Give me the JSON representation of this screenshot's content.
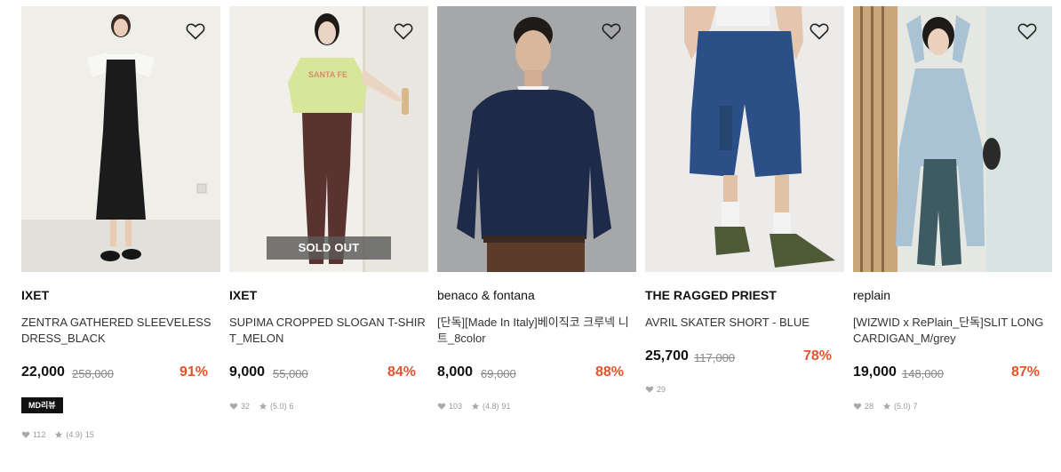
{
  "products": [
    {
      "brand": "IXET",
      "name": "ZENTRA GATHERED SLEEVELESS DRESS_BLACK",
      "price": "22,000",
      "original_price": "258,000",
      "discount": "91%",
      "badge": "MD리뷰",
      "likes": "112",
      "rating": "(4.9)",
      "reviews": "15",
      "image_icon": "woman-in-black-dress-photo"
    },
    {
      "brand": "IXET",
      "name": "SUPIMA CROPPED SLOGAN T-SHIRT_MELON",
      "price": "9,000",
      "original_price": "55,000",
      "discount": "84%",
      "overlay": "SOLD OUT",
      "likes": "32",
      "rating": "(5.0)",
      "reviews": "6",
      "image_icon": "woman-in-green-tshirt-photo"
    },
    {
      "brand": "benaco & fontana",
      "name": "[단독][Made In Italy]베이직코 크루넥 니트_8color",
      "price": "8,000",
      "original_price": "69,000",
      "discount": "88%",
      "likes": "103",
      "rating": "(4.8)",
      "reviews": "91",
      "image_icon": "man-in-navy-sweater-photo"
    },
    {
      "brand": "THE RAGGED PRIEST",
      "name": "AVRIL SKATER SHORT - BLUE",
      "price": "25,700",
      "original_price": "117,000",
      "discount": "78%",
      "likes": "29",
      "image_icon": "denim-shorts-photo"
    },
    {
      "brand": "replain",
      "name": "[WIZWID x RePlain_단독]SLIT LONG CARDIGAN_M/grey",
      "price": "19,000",
      "original_price": "148,000",
      "discount": "87%",
      "likes": "28",
      "rating": "(5.0)",
      "reviews": "7",
      "image_icon": "woman-in-cardigan-photo"
    }
  ],
  "icons": {
    "wishlist": "heart-outline-icon",
    "likes": "heart-filled-icon",
    "rating": "star-icon"
  },
  "colors": {
    "discount": "#e5522d",
    "price": "#111111",
    "original_price": "#888888",
    "badge_bg": "#111111"
  }
}
